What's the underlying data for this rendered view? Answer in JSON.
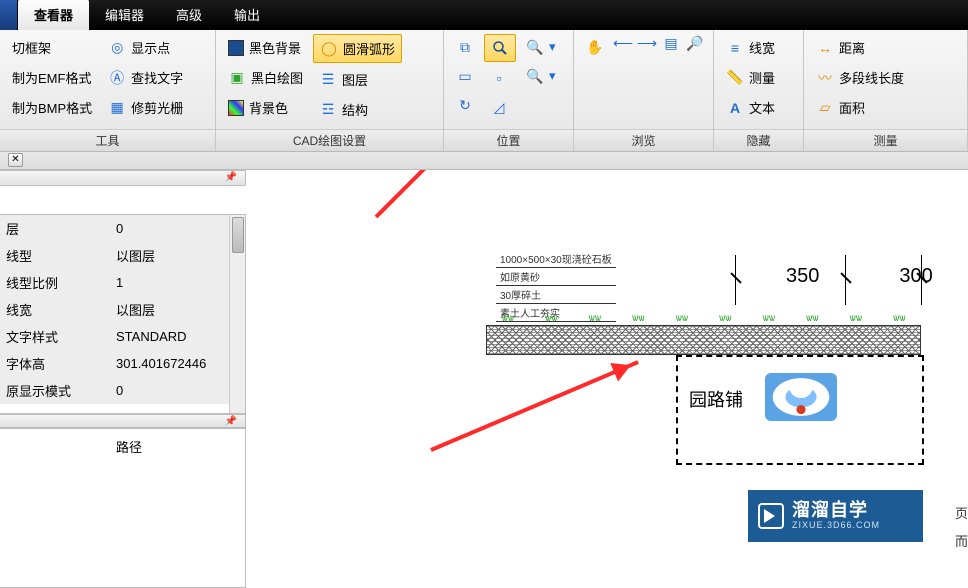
{
  "menu": {
    "tabs": [
      "查看器",
      "编辑器",
      "高级",
      "输出"
    ],
    "active": 0
  },
  "ribbon": {
    "tools": {
      "title": "工具",
      "items": [
        "切框架",
        "制为EMF格式",
        "制为BMP格式",
        "显示点",
        "查找文字",
        "修剪光栅"
      ]
    },
    "cad": {
      "title": "CAD绘图设置",
      "items": [
        "黑色背景",
        "黑白绘图",
        "背景色",
        "圆滑弧形",
        "图层",
        "结构"
      ]
    },
    "position": {
      "title": "位置"
    },
    "browse": {
      "title": "浏览"
    },
    "hide": {
      "title": "隐藏",
      "items": [
        "线宽",
        "测量",
        "文本"
      ]
    },
    "measure": {
      "title": "测量",
      "items": [
        "距离",
        "多段线长度",
        "面积"
      ]
    }
  },
  "properties": {
    "rows": [
      {
        "k": "层",
        "v": "0"
      },
      {
        "k": "线型",
        "v": "以图层"
      },
      {
        "k": "线型比例",
        "v": "1"
      },
      {
        "k": "线宽",
        "v": "以图层"
      },
      {
        "k": "文字样式",
        "v": "STANDARD"
      },
      {
        "k": "字体高",
        "v": "301.401672446"
      },
      {
        "k": "原显示模式",
        "v": "0"
      }
    ]
  },
  "lower": {
    "path_label": "路径"
  },
  "drawing": {
    "note_title": "1000×500×30现浇砼石板",
    "notes": [
      "如原黄砂",
      "30厚碎土",
      "素土人工夯实"
    ],
    "dims": [
      "350",
      "300"
    ],
    "callout": "园路铺"
  },
  "watermark": {
    "big": "溜溜自学",
    "small": "ZIXUE.3D66.COM"
  },
  "right_edge": [
    "页",
    "而"
  ]
}
